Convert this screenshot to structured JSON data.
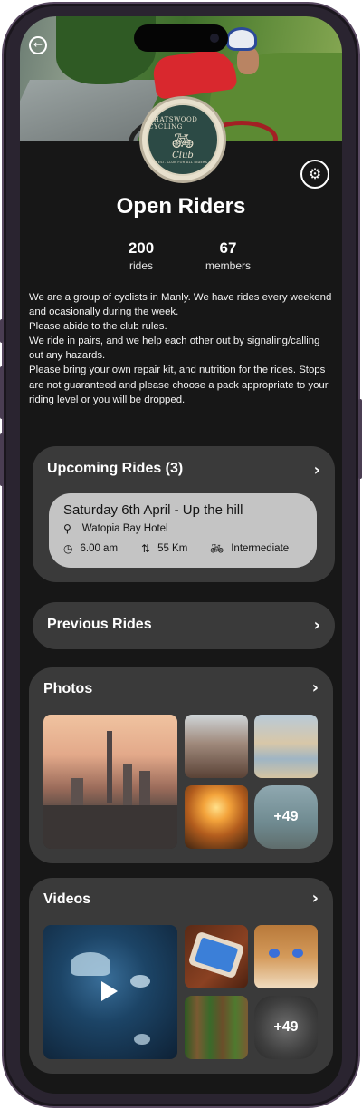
{
  "club": {
    "name": "Open Riders",
    "logo": {
      "top_text": "CHATSWOOD CYCLING",
      "script_text": "Club",
      "bottom_text": "EST. CLUB FOR ALL RIDERS"
    }
  },
  "stats": [
    {
      "value": "200",
      "label": "rides"
    },
    {
      "value": "67",
      "label": "members"
    }
  ],
  "description": "We are a group of cyclists in Manly. We have rides every weekend and ocasionally during the week.\nPlease abide to the club rules.\nWe ride in pairs, and we help each other out by signaling/calling out any hazards.\nPlease bring your own repair kit, and nutrition for the rides. Stops are not guaranteed and please choose a pack appropriate to your riding level or you will be dropped.",
  "upcoming": {
    "title": "Upcoming Rides (3)",
    "ride": {
      "title": "Saturday 6th April - Up the hill",
      "location": "Watopia Bay Hotel",
      "time": "6.00 am",
      "distance": "55 Km",
      "level": "Intermediate"
    }
  },
  "previous": {
    "title": "Previous Rides"
  },
  "photos": {
    "title": "Photos",
    "more": "+49"
  },
  "videos": {
    "title": "Videos",
    "more": "+49"
  },
  "icons": {
    "back": "arrow-left-icon",
    "settings": "gear-icon",
    "chevron": "chevron-right-icon",
    "location": "map-pin-icon",
    "time": "clock-icon",
    "distance": "route-icon",
    "level": "bicycle-icon",
    "play": "play-icon"
  },
  "colors": {
    "background": "#171717",
    "card": "#3a3a3a",
    "ride_card": "#c4c4c4",
    "text": "#ffffff"
  }
}
